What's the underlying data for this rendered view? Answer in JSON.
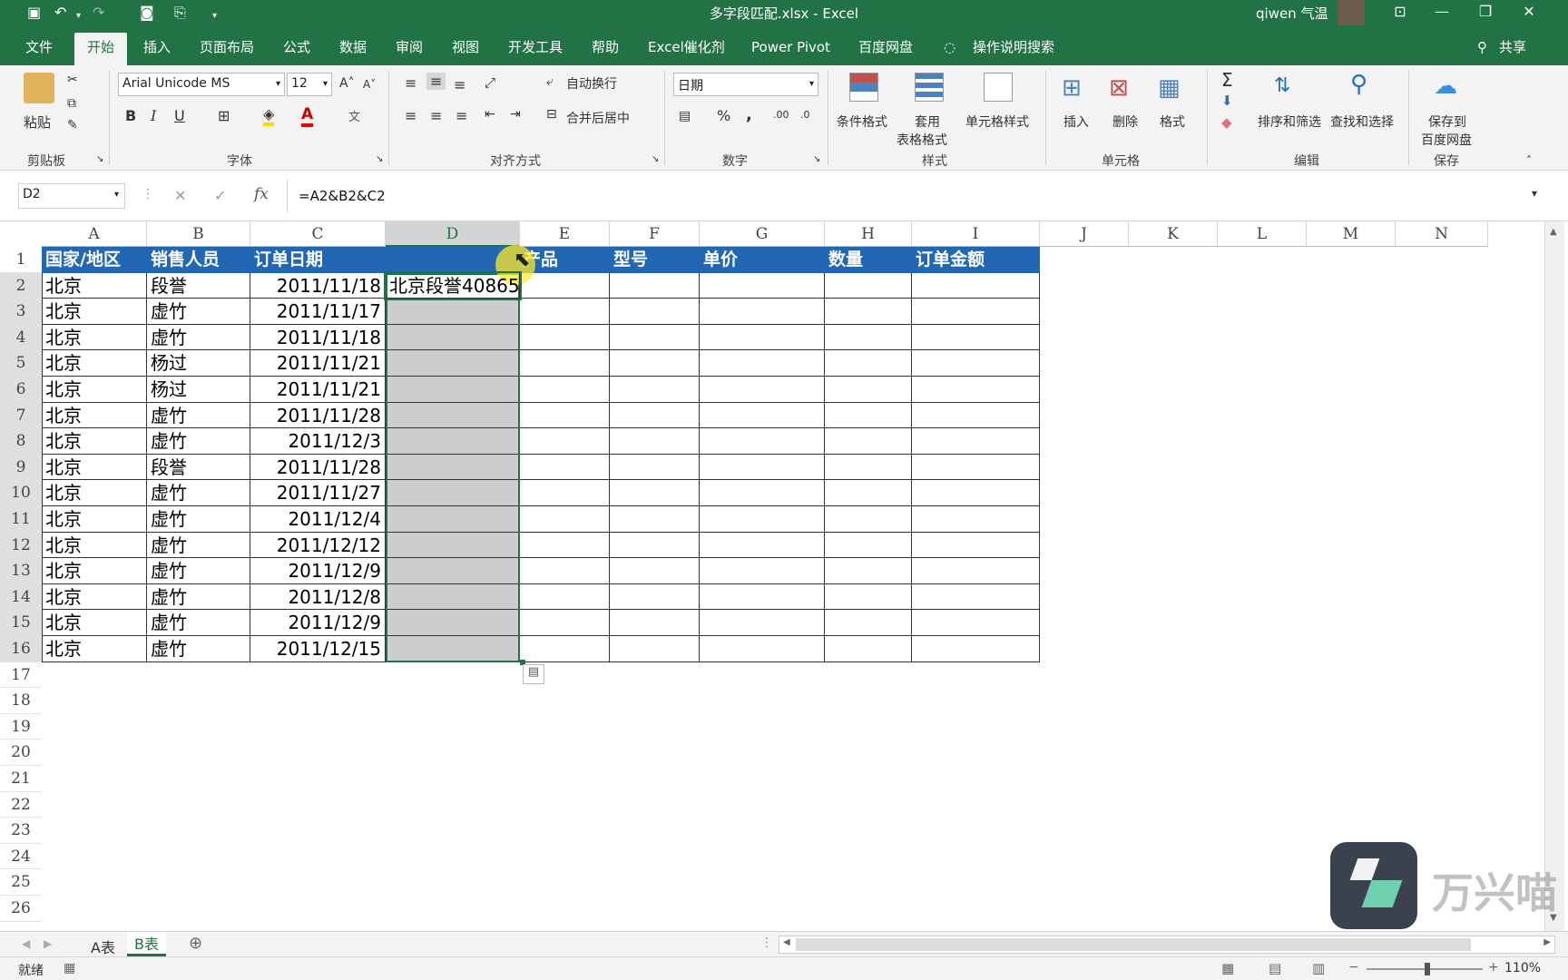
{
  "window": {
    "title": "多字段匹配.xlsx - Excel",
    "user": "qiwen 气温"
  },
  "quick_access": {
    "save_icon": "save-icon",
    "undo_icon": "undo-icon",
    "redo_icon": "redo-icon",
    "camera_icon": "camera-icon",
    "custom_icon": "form-icon",
    "more_icon": "chevron-down-icon"
  },
  "ribbon_tabs": [
    "文件",
    "开始",
    "插入",
    "页面布局",
    "公式",
    "数据",
    "审阅",
    "视图",
    "开发工具",
    "帮助",
    "Excel催化剂",
    "Power Pivot",
    "百度网盘"
  ],
  "tell_me": "操作说明搜索",
  "share": "共享",
  "ribbon": {
    "clipboard": {
      "paste": "粘贴",
      "group": "剪贴板"
    },
    "font": {
      "name": "Arial Unicode MS",
      "size": "12",
      "bold": "B",
      "italic": "I",
      "underline": "U",
      "font_color": "A",
      "group": "字体",
      "phonetic": "文"
    },
    "alignment": {
      "wrap": "自动换行",
      "merge": "合并后居中",
      "group": "对齐方式"
    },
    "number": {
      "format": "日期",
      "percent": "%",
      "comma": ",",
      "inc": ".00",
      "dec": ".0",
      "group": "数字"
    },
    "styles": {
      "cond": "条件格式",
      "table_line1": "套用",
      "table_line2": "表格格式",
      "cell_styles": "单元格样式",
      "group": "样式"
    },
    "cells": {
      "insert": "插入",
      "delete": "删除",
      "format": "格式",
      "group": "单元格"
    },
    "editing": {
      "sort": "排序和筛选",
      "find": "查找和选择",
      "group": "编辑"
    },
    "save": {
      "line1": "保存到",
      "line2": "百度网盘",
      "group": "保存"
    }
  },
  "formula_bar": {
    "name_box": "D2",
    "fx": "fx",
    "formula": "=A2&B2&C2",
    "cancel": "✕",
    "enter": "✓"
  },
  "columns": [
    "A",
    "B",
    "C",
    "D",
    "E",
    "F",
    "G",
    "H",
    "I",
    "J",
    "K",
    "L",
    "M",
    "N"
  ],
  "rows": [
    "1",
    "2",
    "3",
    "4",
    "5",
    "6",
    "7",
    "8",
    "9",
    "10",
    "11",
    "12",
    "13",
    "14",
    "15",
    "16",
    "17",
    "18",
    "19",
    "20",
    "21",
    "22",
    "23",
    "24",
    "25",
    "26"
  ],
  "headers": [
    "国家/地区",
    "销售人员",
    "订单日期",
    "",
    "产品",
    "型号",
    "单价",
    "数量",
    "订单金额"
  ],
  "data_rows": [
    {
      "region": "北京",
      "person": "段誉",
      "date": "2011/11/18",
      "concat": "北京段誉40865"
    },
    {
      "region": "北京",
      "person": "虚竹",
      "date": "2011/11/17",
      "concat": ""
    },
    {
      "region": "北京",
      "person": "虚竹",
      "date": "2011/11/18",
      "concat": ""
    },
    {
      "region": "北京",
      "person": "杨过",
      "date": "2011/11/21",
      "concat": ""
    },
    {
      "region": "北京",
      "person": "杨过",
      "date": "2011/11/21",
      "concat": ""
    },
    {
      "region": "北京",
      "person": "虚竹",
      "date": "2011/11/28",
      "concat": ""
    },
    {
      "region": "北京",
      "person": "虚竹",
      "date": "2011/12/3",
      "concat": ""
    },
    {
      "region": "北京",
      "person": "段誉",
      "date": "2011/11/28",
      "concat": ""
    },
    {
      "region": "北京",
      "person": "虚竹",
      "date": "2011/11/27",
      "concat": ""
    },
    {
      "region": "北京",
      "person": "虚竹",
      "date": "2011/12/4",
      "concat": ""
    },
    {
      "region": "北京",
      "person": "虚竹",
      "date": "2011/12/12",
      "concat": ""
    },
    {
      "region": "北京",
      "person": "虚竹",
      "date": "2011/12/9",
      "concat": ""
    },
    {
      "region": "北京",
      "person": "虚竹",
      "date": "2011/12/8",
      "concat": ""
    },
    {
      "region": "北京",
      "person": "虚竹",
      "date": "2011/12/9",
      "concat": ""
    },
    {
      "region": "北京",
      "person": "虚竹",
      "date": "2011/12/15",
      "concat": ""
    }
  ],
  "sheets": [
    "A表",
    "B表"
  ],
  "active_sheet": "B表",
  "status": {
    "mode": "就绪",
    "zoom": "110%"
  },
  "watermark": {
    "text": "万兴喵"
  },
  "colors": {
    "excel_green": "#217346",
    "header_fill": "#2267b3",
    "selection_fill": "#cdcdcd"
  }
}
